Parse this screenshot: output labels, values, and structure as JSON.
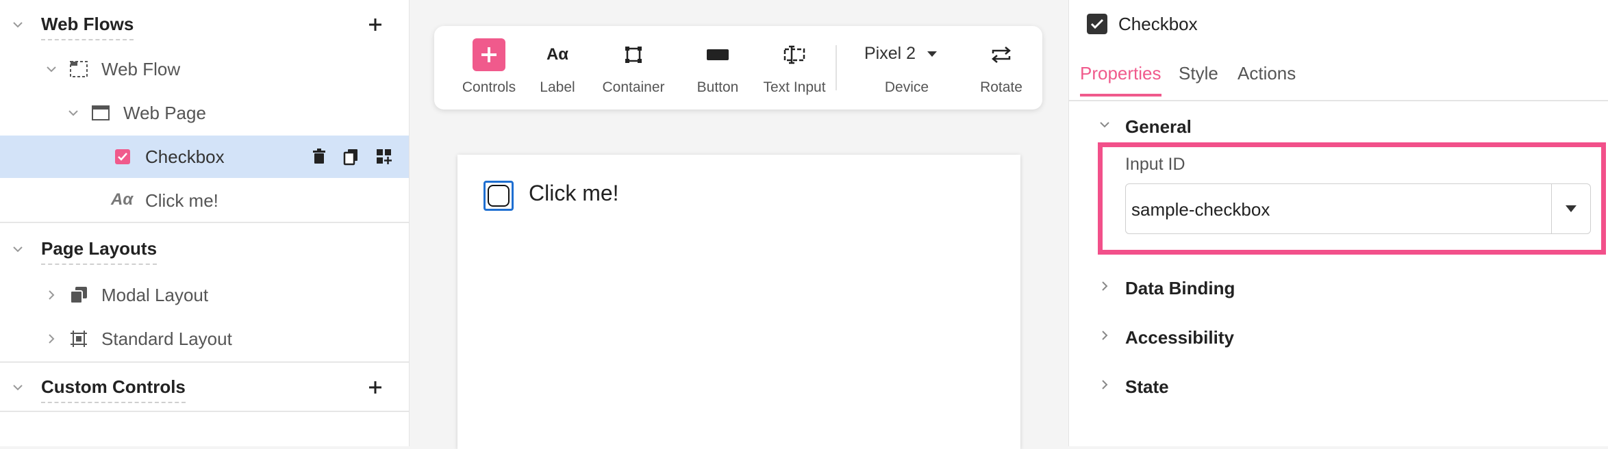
{
  "sidebar": {
    "web_flows": {
      "title": "Web Flows",
      "items": [
        {
          "label": "Web Flow"
        },
        {
          "label": "Web Page"
        },
        {
          "label": "Checkbox"
        },
        {
          "label": "Click me!"
        }
      ]
    },
    "page_layouts": {
      "title": "Page Layouts",
      "items": [
        {
          "label": "Modal Layout"
        },
        {
          "label": "Standard Layout"
        }
      ]
    },
    "custom_controls": {
      "title": "Custom Controls"
    }
  },
  "toolbar": {
    "tools": [
      {
        "label": "Controls",
        "icon": "plus-icon"
      },
      {
        "label": "Label",
        "icon": "label-icon"
      },
      {
        "label": "Container",
        "icon": "container-icon"
      },
      {
        "label": "Button",
        "icon": "button-icon"
      },
      {
        "label": "Text Input",
        "icon": "text-input-icon"
      }
    ],
    "device": {
      "value": "Pixel 2",
      "label": "Device"
    },
    "rotate": {
      "label": "Rotate"
    }
  },
  "canvas": {
    "checkbox_label": "Click me!"
  },
  "panel": {
    "title": "Checkbox",
    "tabs": [
      "Properties",
      "Style",
      "Actions"
    ],
    "active_tab": "Properties",
    "groups": {
      "general": "General",
      "data_binding": "Data Binding",
      "accessibility": "Accessibility",
      "state": "State"
    },
    "input_id": {
      "label": "Input ID",
      "value": "sample-checkbox"
    }
  },
  "colors": {
    "accent": "#f05a8c",
    "selection": "#d3e3f8",
    "focus": "#1f6fd1"
  }
}
